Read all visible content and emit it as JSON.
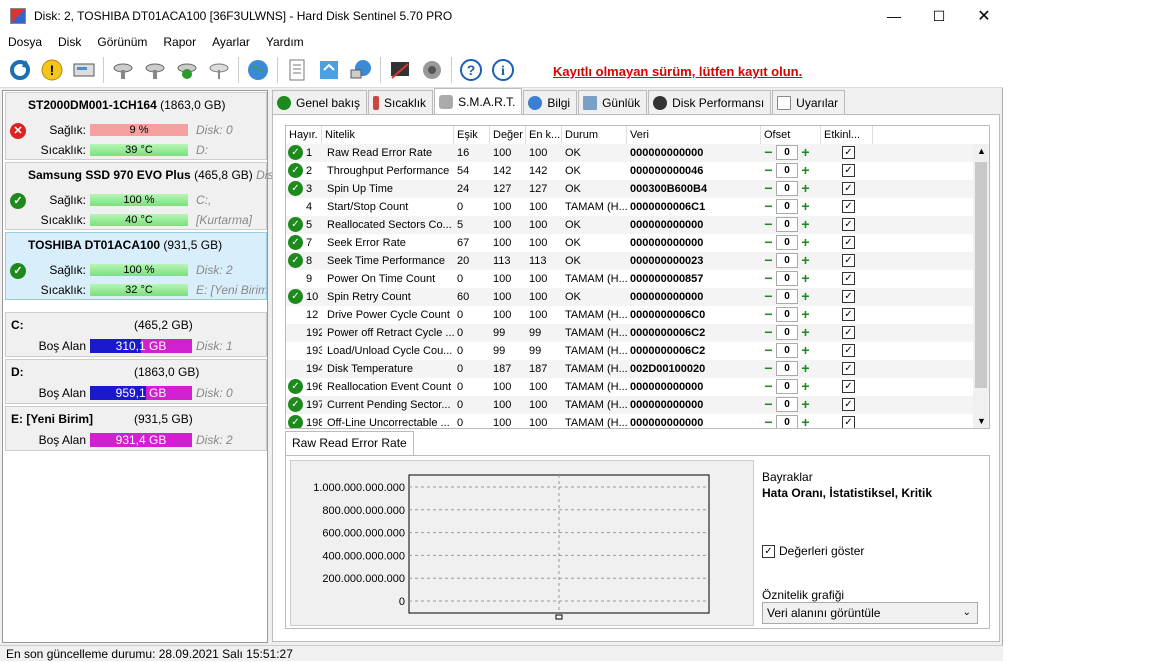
{
  "window": {
    "title": "Disk: 2, TOSHIBA DT01ACA100 [36F3ULWNS]  -  Hard Disk Sentinel 5.70 PRO"
  },
  "menu": [
    "Dosya",
    "Disk",
    "Görünüm",
    "Rapor",
    "Ayarlar",
    "Yardım"
  ],
  "toolbar": {
    "register_text": "Kayıtlı olmayan sürüm, lütfen kayıt olun."
  },
  "disks": [
    {
      "name": "ST2000DM001-1CH164",
      "size": "(1863,0 GB)",
      "status": "bad",
      "health_label": "Sağlık:",
      "health": "9 %",
      "health_pct": 9,
      "temp_label": "Sıcaklık:",
      "temp": "39 °C",
      "note1": "Disk: 0",
      "note2": "D:"
    },
    {
      "name": "Samsung SSD 970 EVO Plus",
      "size": "(465,8 GB)",
      "extra": "Disk:",
      "status": "ok",
      "health_label": "Sağlık:",
      "health": "100 %",
      "health_pct": 100,
      "temp_label": "Sıcaklık:",
      "temp": "40 °C",
      "note1": "C:,",
      "note2": "[Kurtarma]"
    },
    {
      "name": "TOSHIBA DT01ACA100",
      "size": "(931,5 GB)",
      "status": "ok",
      "health_label": "Sağlık:",
      "health": "100 %",
      "health_pct": 100,
      "temp_label": "Sıcaklık:",
      "temp": "32 °C",
      "note1": "Disk: 2",
      "note2": "E: [Yeni Birim"
    }
  ],
  "volumes": [
    {
      "name": "C:",
      "size": "(465,2 GB)",
      "free_label": "Boş Alan",
      "free": "310,1 GB",
      "note": "Disk: 1"
    },
    {
      "name": "D:",
      "size": "(1863,0 GB)",
      "free_label": "Boş Alan",
      "free": "959,1 GB",
      "note": "Disk: 0"
    },
    {
      "name": "E: [Yeni Birim]",
      "size": "(931,5 GB)",
      "free_label": "Boş Alan",
      "free": "931,4 GB",
      "note": "Disk: 2"
    }
  ],
  "tabs": [
    "Genel bakış",
    "Sıcaklık",
    "S.M.A.R.T.",
    "Bilgi",
    "Günlük",
    "Disk Performansı",
    "Uyarılar"
  ],
  "smart": {
    "headers": [
      "Hayır.",
      "Nitelik",
      "Eşik",
      "Değer",
      "En k...",
      "Durum",
      "Veri",
      "Ofset",
      "Etkinl..."
    ],
    "rows": [
      {
        "icon": true,
        "id": "1",
        "name": "Raw Read Error Rate",
        "thr": "16",
        "val": "100",
        "worst": "100",
        "status": "OK",
        "data": "000000000000",
        "ofs": "0"
      },
      {
        "icon": true,
        "id": "2",
        "name": "Throughput Performance",
        "thr": "54",
        "val": "142",
        "worst": "142",
        "status": "OK",
        "data": "000000000046",
        "ofs": "0"
      },
      {
        "icon": true,
        "id": "3",
        "name": "Spin Up Time",
        "thr": "24",
        "val": "127",
        "worst": "127",
        "status": "OK",
        "data": "000300B600B4",
        "ofs": "0"
      },
      {
        "icon": false,
        "id": "4",
        "name": "Start/Stop Count",
        "thr": "0",
        "val": "100",
        "worst": "100",
        "status": "TAMAM (H...",
        "data": "0000000006C1",
        "ofs": "0"
      },
      {
        "icon": true,
        "id": "5",
        "name": "Reallocated Sectors Co...",
        "thr": "5",
        "val": "100",
        "worst": "100",
        "status": "OK",
        "data": "000000000000",
        "ofs": "0"
      },
      {
        "icon": true,
        "id": "7",
        "name": "Seek Error Rate",
        "thr": "67",
        "val": "100",
        "worst": "100",
        "status": "OK",
        "data": "000000000000",
        "ofs": "0"
      },
      {
        "icon": true,
        "id": "8",
        "name": "Seek Time Performance",
        "thr": "20",
        "val": "113",
        "worst": "113",
        "status": "OK",
        "data": "000000000023",
        "ofs": "0"
      },
      {
        "icon": false,
        "id": "9",
        "name": "Power On Time Count",
        "thr": "0",
        "val": "100",
        "worst": "100",
        "status": "TAMAM (H...",
        "data": "000000000857",
        "ofs": "0"
      },
      {
        "icon": true,
        "id": "10",
        "name": "Spin Retry Count",
        "thr": "60",
        "val": "100",
        "worst": "100",
        "status": "OK",
        "data": "000000000000",
        "ofs": "0"
      },
      {
        "icon": false,
        "id": "12",
        "name": "Drive Power Cycle Count",
        "thr": "0",
        "val": "100",
        "worst": "100",
        "status": "TAMAM (H...",
        "data": "0000000006C0",
        "ofs": "0"
      },
      {
        "icon": false,
        "id": "192",
        "name": "Power off Retract Cycle ...",
        "thr": "0",
        "val": "99",
        "worst": "99",
        "status": "TAMAM (H...",
        "data": "0000000006C2",
        "ofs": "0"
      },
      {
        "icon": false,
        "id": "193",
        "name": "Load/Unload Cycle Cou...",
        "thr": "0",
        "val": "99",
        "worst": "99",
        "status": "TAMAM (H...",
        "data": "0000000006C2",
        "ofs": "0"
      },
      {
        "icon": false,
        "id": "194",
        "name": "Disk Temperature",
        "thr": "0",
        "val": "187",
        "worst": "187",
        "status": "TAMAM (H...",
        "data": "002D00100020",
        "ofs": "0"
      },
      {
        "icon": true,
        "id": "196",
        "name": "Reallocation Event Count",
        "thr": "0",
        "val": "100",
        "worst": "100",
        "status": "TAMAM (H...",
        "data": "000000000000",
        "ofs": "0"
      },
      {
        "icon": true,
        "id": "197",
        "name": "Current Pending Sector...",
        "thr": "0",
        "val": "100",
        "worst": "100",
        "status": "TAMAM (H...",
        "data": "000000000000",
        "ofs": "0"
      },
      {
        "icon": true,
        "id": "198",
        "name": "Off-Line Uncorrectable ...",
        "thr": "0",
        "val": "100",
        "worst": "100",
        "status": "TAMAM (H...",
        "data": "000000000000",
        "ofs": "0"
      }
    ]
  },
  "detail": {
    "tab": "Raw Read Error Rate",
    "flags_title": "Bayraklar",
    "flags": "Hata Oranı, İstatistiksel, Kritik",
    "show_values": "Değerleri göster",
    "attr_graph_label": "Öznitelik grafiği",
    "attr_graph_value": "Veri alanını görüntüle"
  },
  "chart_data": {
    "type": "line",
    "yticks": [
      "1.000.000.000.000",
      "800.000.000.000",
      "600.000.000.000",
      "400.000.000.000",
      "200.000.000.000",
      "0"
    ],
    "x": [],
    "values": [
      0
    ],
    "grid": true
  },
  "status": "En son güncelleme durumu: 28.09.2021 Salı 15:51:27"
}
